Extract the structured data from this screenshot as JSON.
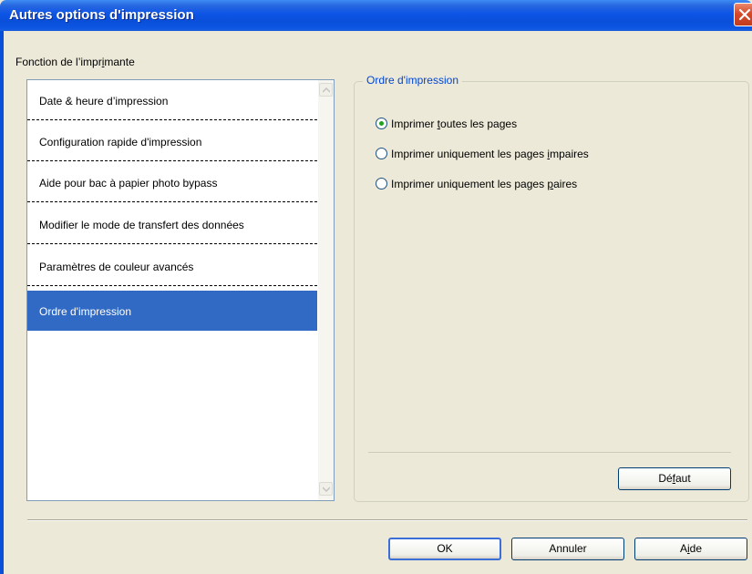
{
  "window": {
    "title": "Autres options d'impression",
    "close_icon": "close-icon"
  },
  "section": {
    "label_pre": "Fonction de l’impr",
    "label_u": "i",
    "label_post": "mante"
  },
  "list": {
    "items": [
      {
        "label": "Date & heure d’impression",
        "selected": false
      },
      {
        "label": "Configuration rapide d'impression",
        "selected": false
      },
      {
        "label": "Aide pour bac à papier photo bypass",
        "selected": false
      },
      {
        "label": "Modifier le mode de transfert des données",
        "selected": false
      },
      {
        "label": "Paramètres de couleur avancés",
        "selected": false
      },
      {
        "label": "Ordre d'impression",
        "selected": true
      }
    ]
  },
  "group": {
    "legend": "Ordre d'impression",
    "options": [
      {
        "pre": "Imprimer ",
        "u": "t",
        "post": "outes les pages",
        "checked": true
      },
      {
        "pre": "Imprimer uniquement les pages ",
        "u": "i",
        "post": "mpaires",
        "checked": false
      },
      {
        "pre": "Imprimer uniquement les pages ",
        "u": "p",
        "post": "aires",
        "checked": false
      }
    ],
    "default_button": {
      "pre": "Dé",
      "u": "f",
      "post": "aut"
    }
  },
  "buttons": {
    "ok": "OK",
    "cancel": "Annuler",
    "help_pre": "A",
    "help_u": "i",
    "help_post": "de"
  },
  "colors": {
    "titlebar": "#0a4fd9",
    "selection": "#316ac5",
    "legend_text": "#0046d5",
    "radio_dot": "#21a121"
  }
}
